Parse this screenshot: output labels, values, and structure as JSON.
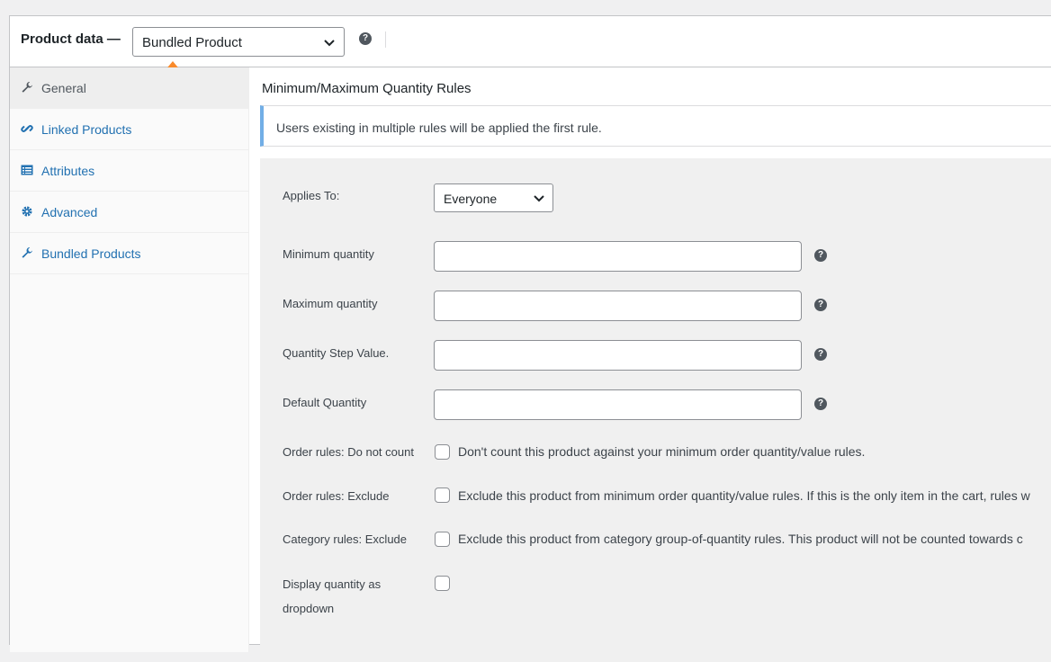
{
  "header": {
    "title": "Product data —",
    "product_type": "Bundled Product",
    "help_glyph": "?"
  },
  "sidebar": {
    "items": [
      {
        "label": "General",
        "icon": "wrench-icon"
      },
      {
        "label": "Linked Products",
        "icon": "link-icon"
      },
      {
        "label": "Attributes",
        "icon": "list-icon"
      },
      {
        "label": "Advanced",
        "icon": "gear-icon"
      },
      {
        "label": "Bundled Products",
        "icon": "wrench-icon"
      }
    ]
  },
  "main": {
    "section_title": "Minimum/Maximum Quantity Rules",
    "notice": "Users existing in multiple rules will be applied the first rule.",
    "applies_to": {
      "label": "Applies To:",
      "value": "Everyone"
    },
    "fields": [
      {
        "label": "Minimum quantity",
        "value": ""
      },
      {
        "label": "Maximum quantity",
        "value": ""
      },
      {
        "label": "Quantity Step Value.",
        "value": ""
      },
      {
        "label": "Default Quantity",
        "value": ""
      }
    ],
    "checkboxes": [
      {
        "label": "Order rules: Do not count",
        "text": "Don't count this product against your minimum order quantity/value rules."
      },
      {
        "label": "Order rules: Exclude",
        "text": "Exclude this product from minimum order quantity/value rules. If this is the only item in the cart, rules w"
      },
      {
        "label": "Category rules: Exclude",
        "text": "Exclude this product from category group-of-quantity rules. This product will not be counted towards c"
      },
      {
        "label": "Display quantity as dropdown",
        "text": ""
      }
    ]
  },
  "colors": {
    "link": "#2271b1",
    "arrow": "#f98a2b",
    "notice_border": "#72aee6"
  }
}
